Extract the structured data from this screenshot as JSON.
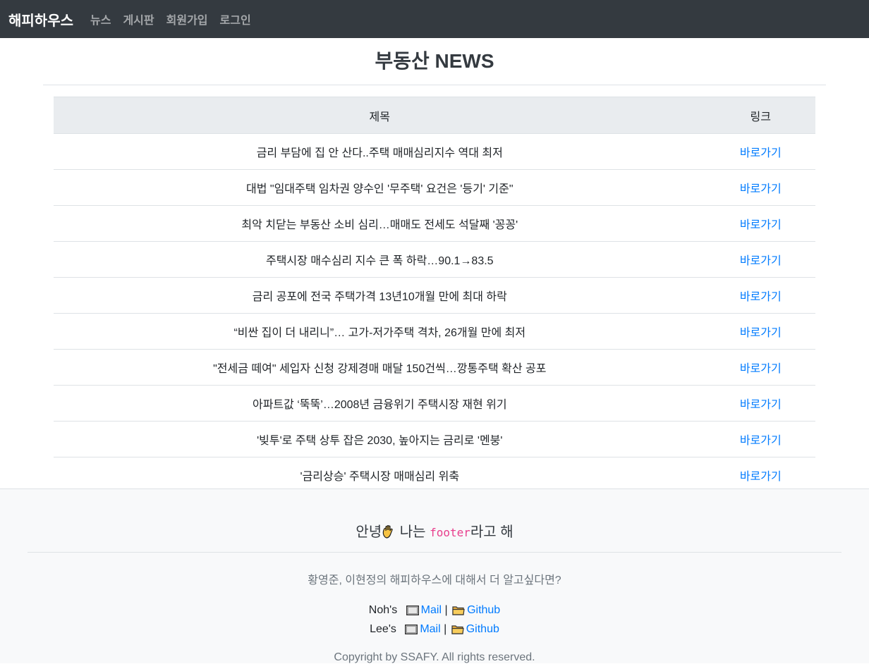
{
  "navbar": {
    "brand": "해피하우스",
    "links": [
      "뉴스",
      "게시판",
      "회원가입",
      "로그인"
    ]
  },
  "page": {
    "title": "부동산 NEWS"
  },
  "table": {
    "headers": {
      "title": "제목",
      "link": "링크"
    },
    "rows": [
      {
        "title": "금리 부담에 집 안 산다..주택 매매심리지수 역대 최저",
        "link": "바로가기"
      },
      {
        "title": "대법 \"임대주택 임차권 양수인 '무주택' 요건은 '등기' 기준\"",
        "link": "바로가기"
      },
      {
        "title": "최악 치닫는 부동산 소비 심리…매매도 전세도 석달째 '꽁꽁'",
        "link": "바로가기"
      },
      {
        "title": "주택시장 매수심리 지수 큰 폭 하락…90.1→83.5",
        "link": "바로가기"
      },
      {
        "title": "금리 공포에 전국 주택가격 13년10개월 만에 최대 하락",
        "link": "바로가기"
      },
      {
        "title": "“비싼 집이 더 내리니”… 고가-저가주택 격차, 26개월 만에 최저",
        "link": "바로가기"
      },
      {
        "title": "\"전세금 떼여\" 세입자 신청 강제경매 매달 150건씩…깡통주택 확산 공포",
        "link": "바로가기"
      },
      {
        "title": "아파트값 ‘뚝뚝’…2008년 금융위기 주택시장 재현 위기",
        "link": "바로가기"
      },
      {
        "title": "'빚투'로 주택 상투 잡은 2030, 높아지는 금리로 '멘붕'",
        "link": "바로가기"
      },
      {
        "title": "'금리상승' 주택시장 매매심리 위축",
        "link": "바로가기"
      }
    ]
  },
  "footer": {
    "greet_before": "안녕",
    "greet_mid": " 나는 ",
    "greet_code": "footer",
    "greet_after": "라고 해",
    "about": "황영준, 이현정의 해피하우스에 대해서 더 알고싶다면?",
    "contacts": [
      {
        "who": "Noh's",
        "mail": "Mail",
        "sep": "|",
        "github": "Github"
      },
      {
        "who": "Lee's",
        "mail": "Mail",
        "sep": "|",
        "github": "Github"
      }
    ],
    "copyright": "Copyright by SSAFY. All rights reserved."
  },
  "colors": {
    "navbar_bg": "#343a40",
    "link": "#007bff",
    "code": "#e83e8c",
    "footer_bg": "#f8f9fa"
  },
  "icons": [
    "waving-hand-icon",
    "envelope-icon",
    "folder-icon"
  ]
}
